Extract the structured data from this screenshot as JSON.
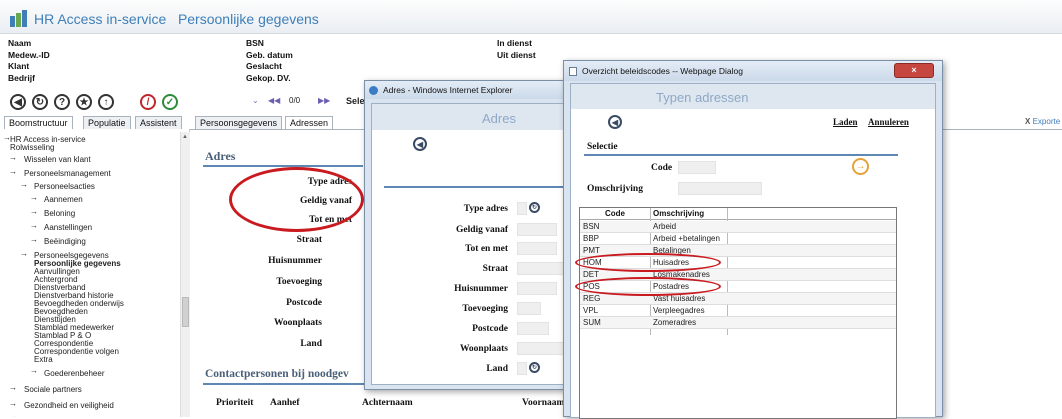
{
  "app": {
    "title": "HR Access in-service",
    "page": "Persoonlijke gegevens"
  },
  "header_fields": {
    "col1": [
      "Naam",
      "Medew.-ID",
      "Klant",
      "Bedrijf"
    ],
    "col2": [
      "BSN",
      "Geb. datum",
      "Geslacht",
      "Gekop. DV."
    ],
    "col3": [
      "In dienst",
      "Uit dienst"
    ]
  },
  "toolbar": {
    "page_value": "0/0",
    "select_label": "Sele"
  },
  "tabs_left": [
    "Boomstructuur",
    "Populatie",
    "Assistent"
  ],
  "tabs_main": [
    "Persoonsgegevens",
    "Adressen"
  ],
  "export_label": "Exporte",
  "tree": [
    "HR Access in-service",
    "Rolwisseling",
    "Wisselen van klant",
    "Personeelsmanagement",
    "Personeelsacties",
    "Aannemen",
    "Beloning",
    "Aanstellingen",
    "Beëindiging",
    "Personeelsgegevens",
    "Persoonlijke gegevens",
    "Aanvullingen",
    "Achtergrond",
    "Dienstverband",
    "Dienstverband historie",
    "Bevoegdheden onderwijs",
    "Bevoegdheden",
    "Diensttijden",
    "Stamblad medewerker",
    "Stamblad P & O",
    "Correspondentie",
    "Correspondentie volgen",
    "Extra",
    "Goederenbeheer",
    "Sociale partners",
    "Gezondheid en veiligheid"
  ],
  "adres": {
    "heading": "Adres",
    "labels": [
      "Type adres",
      "Geldig vanaf",
      "Tot en met",
      "Straat",
      "Huisnummer",
      "Toevoeging",
      "Postcode",
      "Woonplaats",
      "Land"
    ]
  },
  "contact": {
    "heading": "Contactpersonen bij noodgev",
    "columns": [
      "Prioriteit",
      "Aanhef",
      "Achternaam",
      "Voornaam"
    ]
  },
  "dialog_adres": {
    "window_title": "Adres - Windows Internet Explorer",
    "heading": "Adres",
    "labels": [
      "Type adres",
      "Geldig vanaf",
      "Tot en met",
      "Straat",
      "Huisnummer",
      "Toevoeging",
      "Postcode",
      "Woonplaats",
      "Land"
    ]
  },
  "dialog_codes": {
    "window_title": "Overzicht beleidscodes -- Webpage Dialog",
    "heading": "Typen adressen",
    "laden": "Laden",
    "annuleren": "Annuleren",
    "selectie": "Selectie",
    "code_label": "Code",
    "omschrijving_label": "Omschrijving",
    "columns": [
      "Code",
      "Omschrijving"
    ],
    "rows": [
      [
        "BSN",
        "Arbeid"
      ],
      [
        "BBP",
        "Arbeid +betalingen"
      ],
      [
        "PMT",
        "Betalingen"
      ],
      [
        "HOM",
        "Huisadres"
      ],
      [
        "DET",
        "Losmakenadres"
      ],
      [
        "POS",
        "Postadres"
      ],
      [
        "REG",
        "Vast huisadres"
      ],
      [
        "VPL",
        "Verpleegadres"
      ],
      [
        "SUM",
        "Zomeradres"
      ]
    ]
  },
  "colors": {
    "accent": "#3e7fb8",
    "annotation": "#c91a20",
    "heading": "#4a5f78"
  }
}
